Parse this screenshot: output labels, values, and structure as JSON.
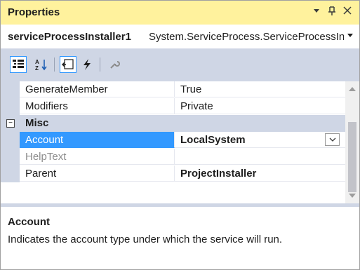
{
  "panel": {
    "title": "Properties",
    "controls": {
      "dropdown_glyph": "▾",
      "pin_glyph": "ꟼ",
      "close_glyph": "✕"
    }
  },
  "selector": {
    "object_name": "serviceProcessInstaller1",
    "object_type": "System.ServiceProcess.ServiceProcessInstaller",
    "arrow_glyph": "▾"
  },
  "toolbar": {
    "buttons": [
      {
        "icon": "categorized-icon",
        "active": true
      },
      {
        "icon": "alphabetical-icon",
        "active": false
      },
      {
        "icon": "properties-icon",
        "active": true
      },
      {
        "icon": "events-icon",
        "active": false
      },
      {
        "icon": "property-pages-icon",
        "active": false
      }
    ]
  },
  "grid": {
    "rows": [
      {
        "name": "GenerateMember",
        "value": "True"
      },
      {
        "name": "Modifiers",
        "value": "Private"
      }
    ],
    "category": {
      "label": "Misc",
      "toggle": "⊟"
    },
    "misc_rows": [
      {
        "name": "Account",
        "value": "LocalSystem",
        "selected": true,
        "bold": true
      },
      {
        "name": "HelpText",
        "value": "",
        "disabled": true
      },
      {
        "name": "Parent",
        "value": "ProjectInstaller",
        "bold": true
      }
    ]
  },
  "description": {
    "title": "Account",
    "text": "Indicates the account type under which the service will run."
  },
  "colors": {
    "title_bg": "#fff29d",
    "toolbar_bg": "#cfd6e5",
    "selection": "#3399ff"
  }
}
